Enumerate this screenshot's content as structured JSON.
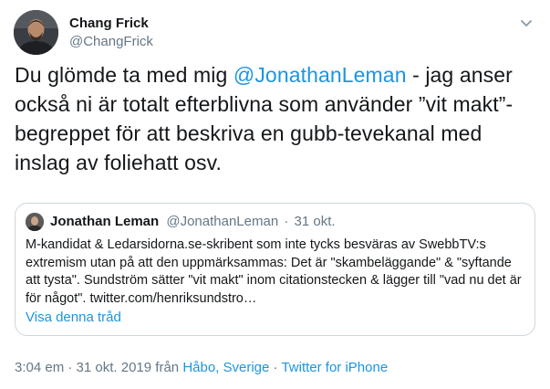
{
  "author": {
    "name": "Chang Frick",
    "handle": "@ChangFrick"
  },
  "tweet": {
    "text_before": "Du glömde ta med mig ",
    "mention": "@JonathanLeman",
    "text_after": " - jag anser också ni är totalt efterblivna som använder ”vit makt”-begreppet för att beskriva en gubb-tevekanal med inslag av foliehatt osv."
  },
  "quote": {
    "name": "Jonathan Leman",
    "handle": "@JonathanLeman",
    "separator": "·",
    "date": "31 okt.",
    "text": "M-kandidat & Ledarsidorna.se-skribent som inte tycks  besväras av SwebbTV:s extremism utan på att den uppmärksammas: Det är \"skambeläggande\" & \"syftande att tysta\". Sundström sätter \"vit makt\" inom citationstecken & lägger till \"vad nu det är för något\". twitter.com/henriksundstro…",
    "thread_link": "Visa denna tråd"
  },
  "footer": {
    "time": "3:04 em",
    "sep1": " · ",
    "date": "31 okt. 2019",
    "from": " från ",
    "location": "Håbo, Sverige",
    "sep2": " · ",
    "source": "Twitter for iPhone"
  },
  "icons": {
    "menu": "chevron-down-icon"
  },
  "colors": {
    "link": "#1b95e0",
    "secondary_text": "#657786",
    "border": "#ccd6dd"
  }
}
